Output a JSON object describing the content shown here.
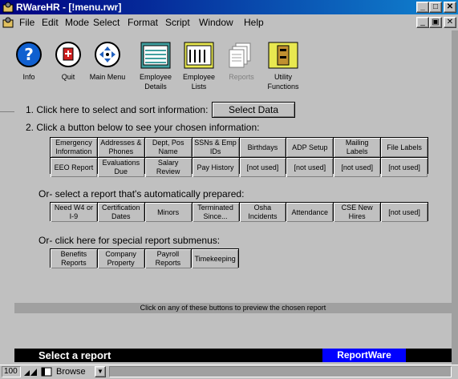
{
  "window": {
    "title": "RWareHR - [!menu.rwr]"
  },
  "menu": [
    "File",
    "Edit",
    "Mode",
    "Select",
    "Format",
    "Script",
    "Window",
    "Help"
  ],
  "toolbar": {
    "info": "Info",
    "quit": "Quit",
    "main_menu": "Main Menu",
    "employee_details": "Employee Details",
    "employee_lists": "Employee Lists",
    "reports": "Reports",
    "utility_functions": "Utility Functions"
  },
  "steps": {
    "step1": "1.  Click here to select and sort information:",
    "select_data": "Select Data",
    "step2": "2.  Click a button below to see your chosen information:",
    "or_auto": "Or- select a report that's automatically prepared:",
    "or_special": "Or- click here for special report submenus:"
  },
  "info_grid": [
    [
      "Emergency Information",
      "Addresses & Phones",
      "Dept, Pos Name",
      "SSNs & Emp IDs",
      "Birthdays",
      "ADP Setup",
      "Mailing Labels",
      "File Labels"
    ],
    [
      "EEO Report",
      "Evaluations Due",
      "Salary Review",
      "Pay History",
      "[not used]",
      "[not used]",
      "[not used]",
      "[not used]"
    ]
  ],
  "auto_grid": [
    "Need W4 or I-9",
    "Certification Dates",
    "Minors",
    "Terminated Since...",
    "Osha Incidents",
    "Attendance",
    "CSE New Hires",
    "[not used]"
  ],
  "special_grid": [
    "Benefits Reports",
    "Company Property",
    "Payroll Reports",
    "Timekeeping"
  ],
  "status_hint": "Click on any of these buttons to preview the chosen report",
  "bottom": {
    "message": "Select a report",
    "brand": "ReportWare"
  },
  "statusbar": {
    "zoom": "100",
    "mode": "Browse"
  }
}
